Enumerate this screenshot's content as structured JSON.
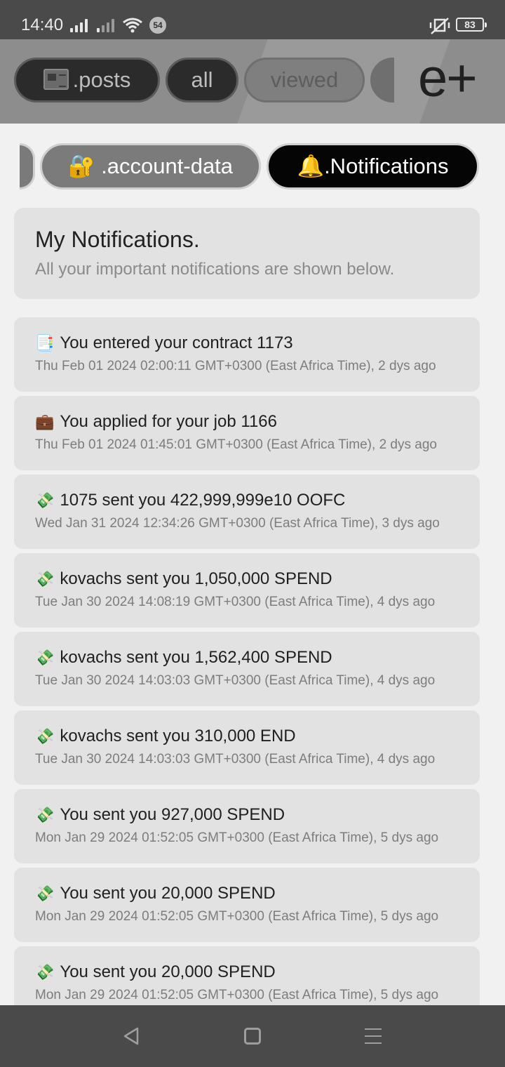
{
  "status_bar": {
    "time": "14:40",
    "notification_count": "54",
    "battery": "83",
    "icons": [
      "signal-icon",
      "signal-no-service-icon",
      "wifi-icon",
      "mute-vibrate-icon",
      "battery-icon"
    ]
  },
  "header": {
    "tabs": [
      {
        "label": ".posts",
        "icon": "newspaper-icon"
      },
      {
        "label": "all"
      },
      {
        "label": "viewed"
      }
    ],
    "logo": "e+"
  },
  "sheet_tabs": {
    "account": {
      "emoji": "🔐",
      "label": ".account-data"
    },
    "notifications": {
      "emoji": "🔔",
      "label": ".Notifications"
    }
  },
  "intro": {
    "title": "My Notifications.",
    "subtitle": "All your important notifications are shown below."
  },
  "notifications": [
    {
      "icon": "📑",
      "icon_name": "bookmark-tabs-icon",
      "message": "You entered your contract 1173",
      "time": "Thu Feb 01 2024 02:00:11 GMT+0300 (East Africa Time), 2 dys ago"
    },
    {
      "icon": "💼",
      "icon_name": "briefcase-icon",
      "message": "You applied for your job 1166",
      "time": "Thu Feb 01 2024 01:45:01 GMT+0300 (East Africa Time), 2 dys ago"
    },
    {
      "icon": "💸",
      "icon_name": "money-flying-icon",
      "message": "1075 sent you 422,999,999e10 OOFC",
      "time": "Wed Jan 31 2024 12:34:26 GMT+0300 (East Africa Time), 3 dys ago"
    },
    {
      "icon": "💸",
      "icon_name": "money-flying-icon",
      "message": "kovachs sent you 1,050,000 SPEND",
      "time": "Tue Jan 30 2024 14:08:19 GMT+0300 (East Africa Time), 4 dys ago"
    },
    {
      "icon": "💸",
      "icon_name": "money-flying-icon",
      "message": "kovachs sent you 1,562,400 SPEND",
      "time": "Tue Jan 30 2024 14:03:03 GMT+0300 (East Africa Time), 4 dys ago"
    },
    {
      "icon": "💸",
      "icon_name": "money-flying-icon",
      "message": "kovachs sent you 310,000 END",
      "time": "Tue Jan 30 2024 14:03:03 GMT+0300 (East Africa Time), 4 dys ago"
    },
    {
      "icon": "💸",
      "icon_name": "money-flying-icon",
      "message": "You sent you 927,000 SPEND",
      "time": "Mon Jan 29 2024 01:52:05 GMT+0300 (East Africa Time), 5 dys ago"
    },
    {
      "icon": "💸",
      "icon_name": "money-flying-icon",
      "message": "You sent you 20,000 SPEND",
      "time": "Mon Jan 29 2024 01:52:05 GMT+0300 (East Africa Time), 5 dys ago"
    },
    {
      "icon": "💸",
      "icon_name": "money-flying-icon",
      "message": "You sent you 20,000 SPEND",
      "time": "Mon Jan 29 2024 01:52:05 GMT+0300 (East Africa Time), 5 dys ago"
    }
  ],
  "nav": {
    "icons": [
      "back-icon",
      "home-icon",
      "recents-icon"
    ]
  },
  "colors": {
    "active_tab_bg": "#050505",
    "inactive_tab_bg": "#7b7b7b",
    "card_bg": "#e2e2e2",
    "sheet_bg": "#f1f1f1",
    "system_bar": "#4a4a4a"
  }
}
